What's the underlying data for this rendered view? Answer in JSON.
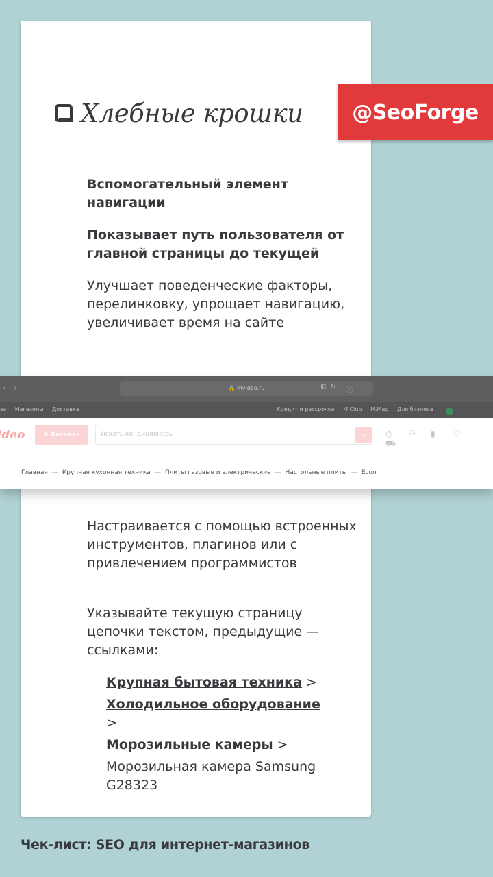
{
  "card": {
    "title": "Хлебные крошки",
    "badge": "@SeoForge",
    "points": [
      "Вспомогательный элемент навигации",
      "Показывает путь пользователя от главной страницы до текущей",
      "Улучшает поведенческие факторы, перелинковку, упрощает навигацию, увеличивает время на сайте",
      "Настраивается с помощью встроенных инструментов, плагинов или с привлечением программистов",
      "Указывайте текущую страницу цепочки текстом, предыдущие — ссылками:"
    ],
    "example": {
      "links": [
        "Крупная бытовая техника",
        "Холодильное оборудование",
        "Морозильные камеры"
      ],
      "separator": ">",
      "current": "Морозильная камера Samsung G28323"
    }
  },
  "browser": {
    "url": "mvideo.ru",
    "bookmarks_left": [
      "за",
      "Магазины",
      "Доставка"
    ],
    "bookmarks_right": [
      "Кредит и рассрочка",
      "M.Club",
      "M.Mag",
      "Для бизнеса"
    ],
    "logo": "ideo",
    "catalog_label": "≡ Каталог",
    "search_placeholder": "Искать кондиционеры",
    "breadcrumbs": [
      "Главная",
      "Крупная кухонная техника",
      "Плиты газовые и электрические",
      "Настольные плиты",
      "Econ"
    ],
    "crumb_separator": "—"
  },
  "footer": "Чек-лист: SEO для интернет-магазинов"
}
